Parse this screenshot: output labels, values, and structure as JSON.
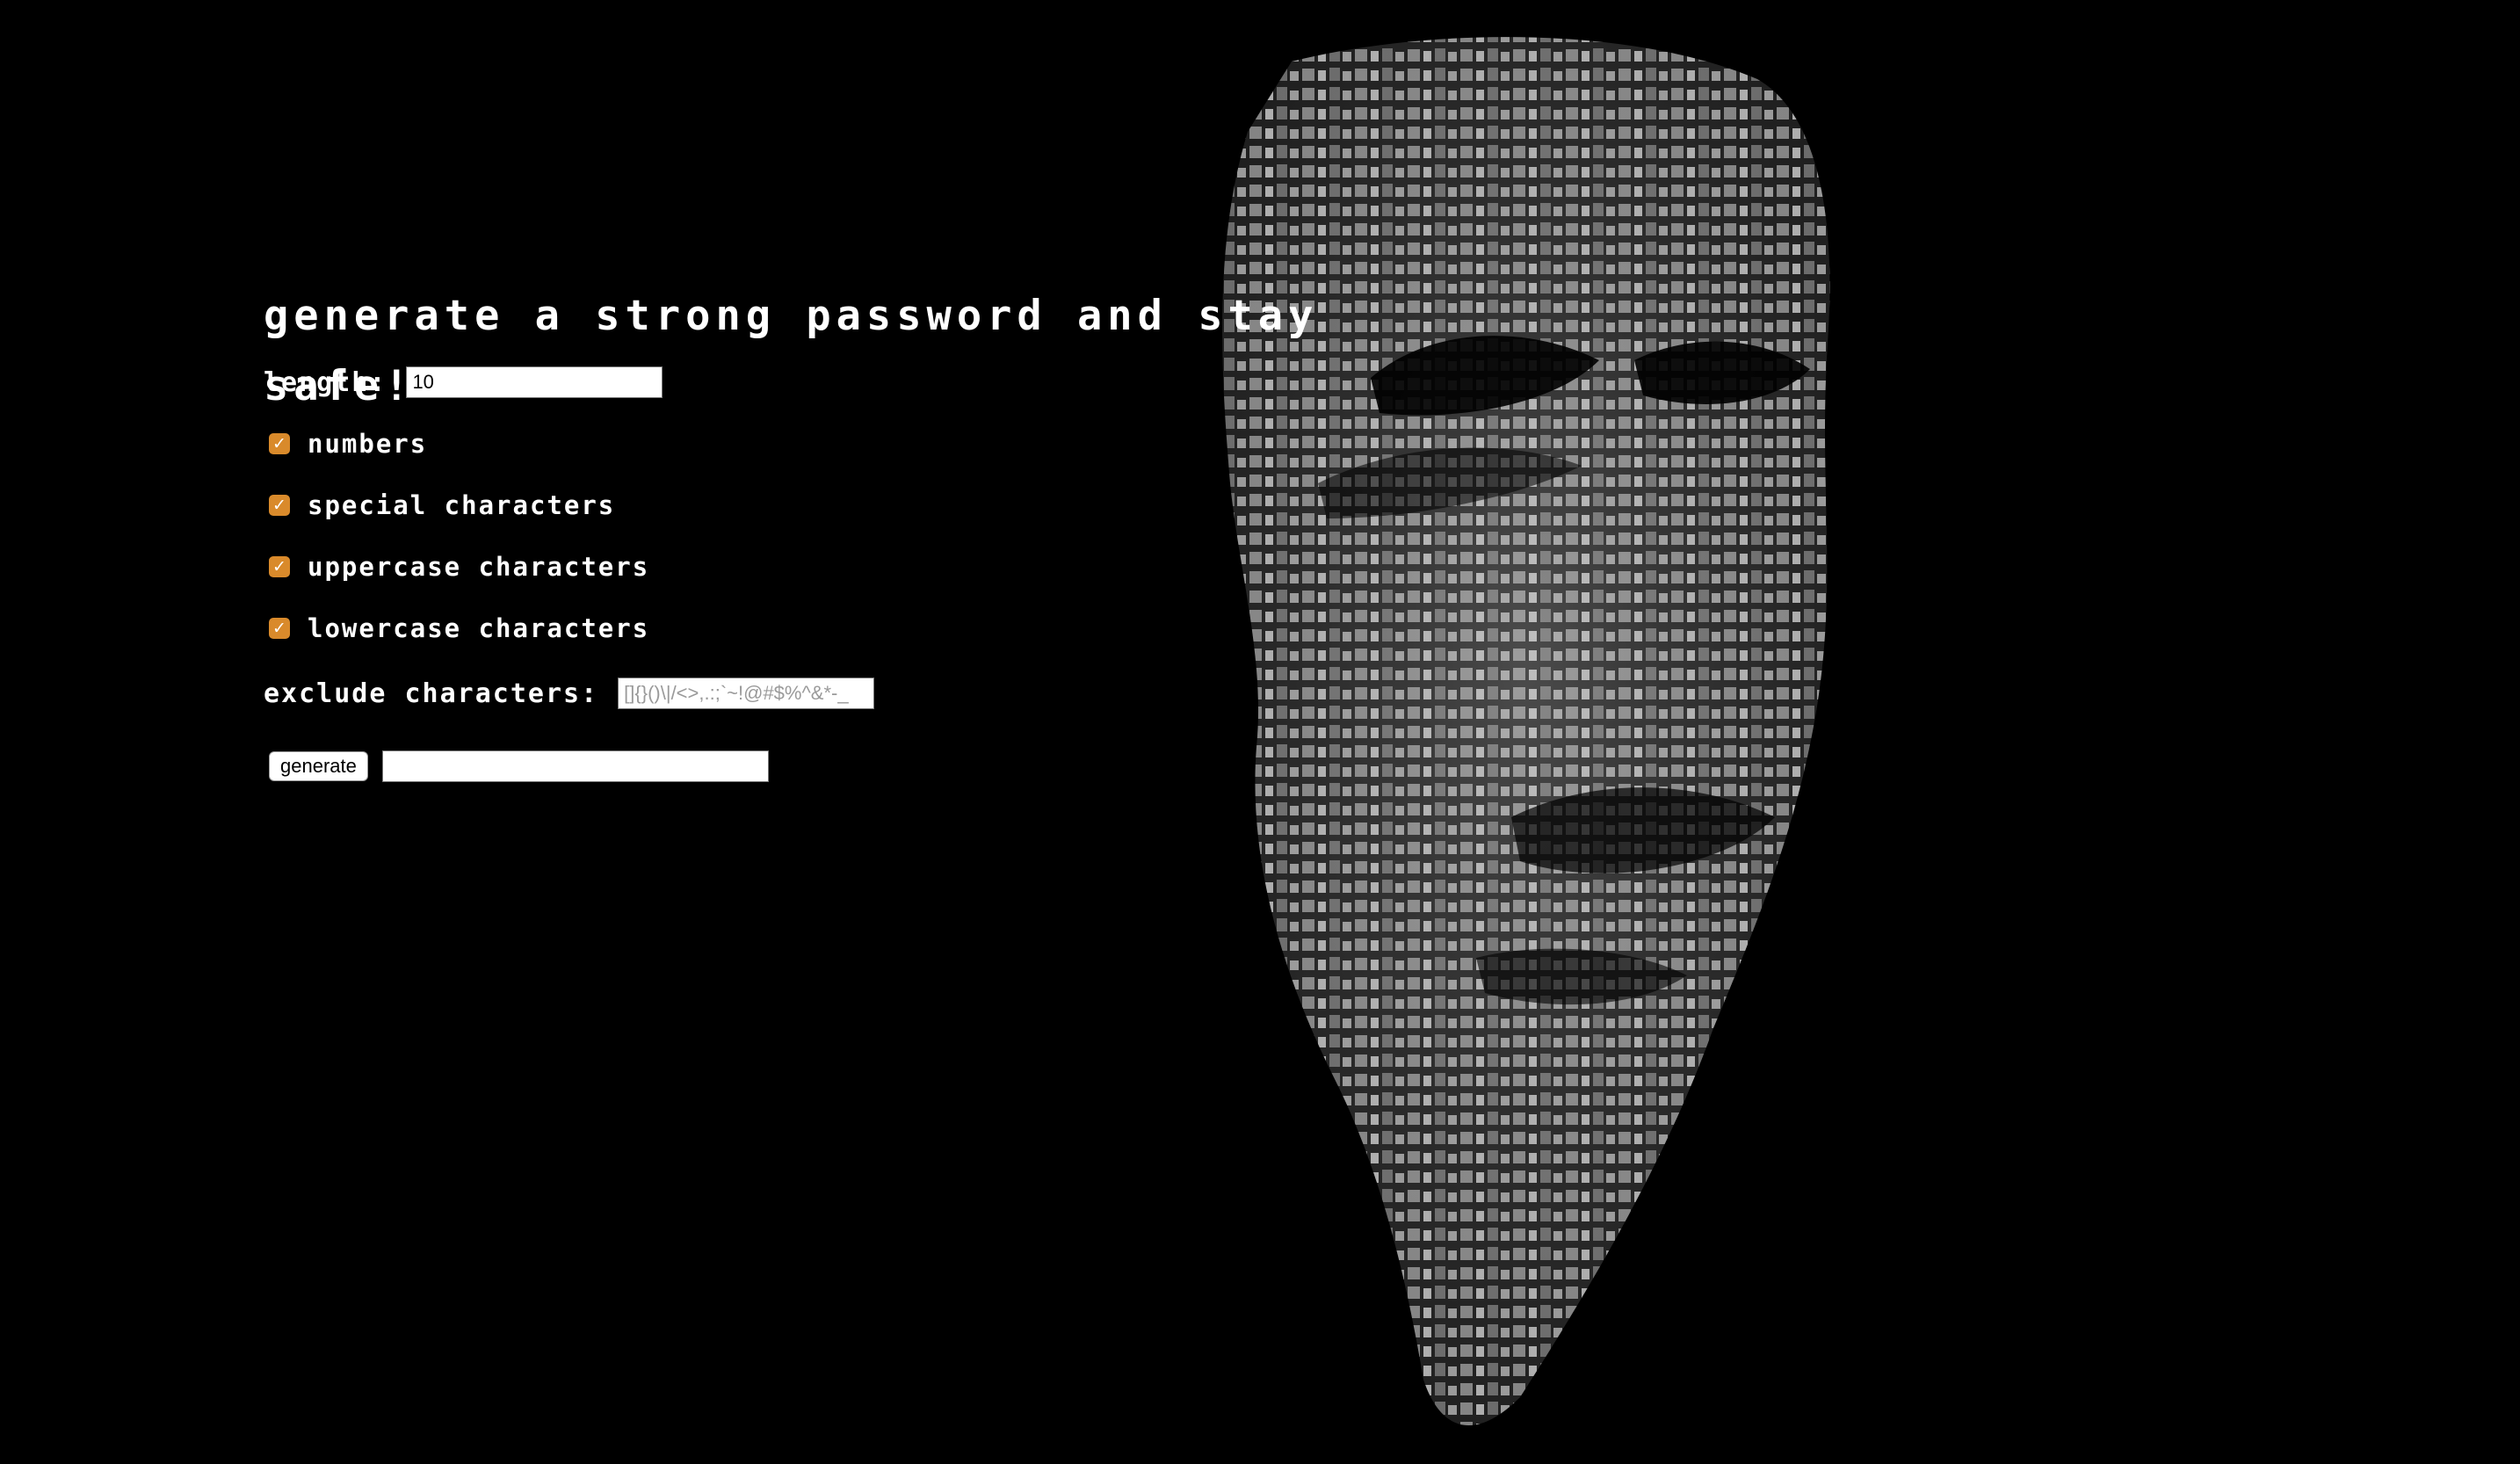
{
  "page": {
    "title": "generate a strong password and stay safe!"
  },
  "length": {
    "label": "length:",
    "value": "10"
  },
  "options": [
    {
      "label": "numbers",
      "checked": true
    },
    {
      "label": "special characters",
      "checked": true
    },
    {
      "label": "uppercase characters",
      "checked": true
    },
    {
      "label": "lowercase characters",
      "checked": true
    }
  ],
  "exclude": {
    "label": "exclude characters:",
    "placeholder": "[]{}()\\|/<>,.:;`~!@#$%^&*-_",
    "value": ""
  },
  "generate": {
    "button_label": "generate",
    "output_value": ""
  },
  "background": {
    "icon": "guy-fawkes-mask-typography-art"
  },
  "colors": {
    "background": "#000000",
    "text": "#ffffff",
    "checkbox_accent": "#d98a2b"
  }
}
